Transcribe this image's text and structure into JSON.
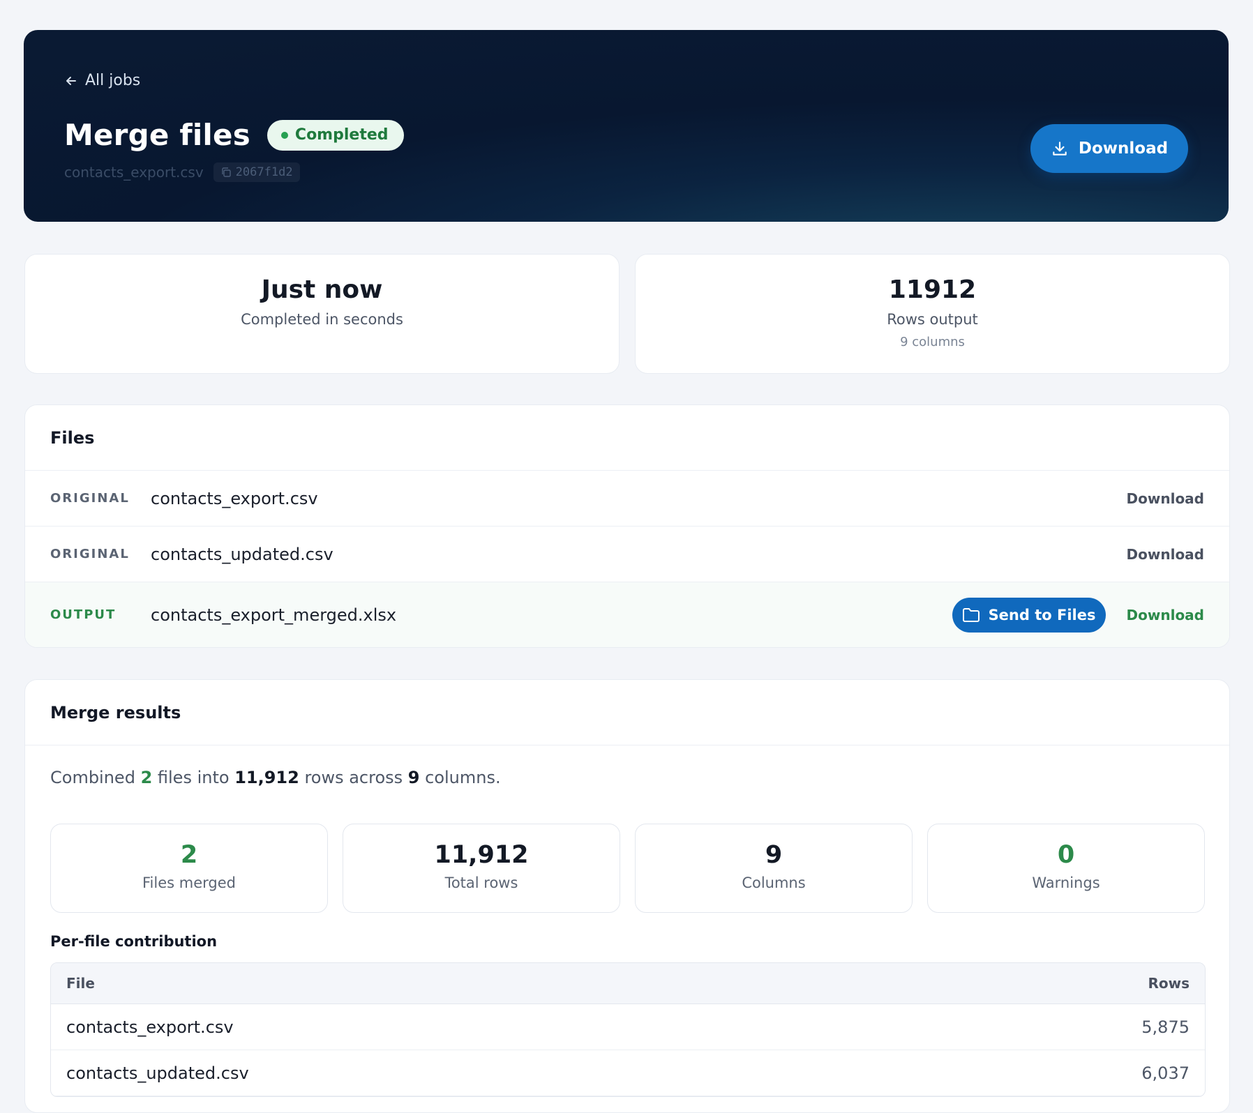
{
  "header": {
    "back_label": "All jobs",
    "title": "Merge files",
    "status": "Completed",
    "filename": "contacts_export.csv",
    "job_id": "2067f1d2",
    "download_label": "Download"
  },
  "stats": {
    "time": {
      "value": "Just now",
      "label": "Completed in seconds"
    },
    "rows": {
      "value": "11912",
      "label": "Rows output",
      "sub": "9 columns"
    }
  },
  "files": {
    "title": "Files",
    "items": [
      {
        "tag": "ORIGINAL",
        "name": "contacts_export.csv",
        "action": "Download"
      },
      {
        "tag": "ORIGINAL",
        "name": "contacts_updated.csv",
        "action": "Download"
      },
      {
        "tag": "OUTPUT",
        "name": "contacts_export_merged.xlsx",
        "action": "Download",
        "send_label": "Send to Files"
      }
    ]
  },
  "results": {
    "title": "Merge results",
    "summary": {
      "p1": "Combined ",
      "files": "2",
      "p2": " files into ",
      "rows": "11,912",
      "p3": " rows across ",
      "cols": "9",
      "p4": " columns."
    },
    "cards": [
      {
        "value": "2",
        "label": "Files merged"
      },
      {
        "value": "11,912",
        "label": "Total rows"
      },
      {
        "value": "9",
        "label": "Columns"
      },
      {
        "value": "0",
        "label": "Warnings"
      }
    ],
    "contribution": {
      "title": "Per-file contribution",
      "columns": [
        "File",
        "Rows"
      ],
      "rows": [
        {
          "file": "contacts_export.csv",
          "rows": "5,875"
        },
        {
          "file": "contacts_updated.csv",
          "rows": "6,037"
        }
      ]
    }
  },
  "colors": {
    "accent": "#1676c9",
    "success": "#2c8a4a",
    "hero_bg": "#0b2340"
  }
}
